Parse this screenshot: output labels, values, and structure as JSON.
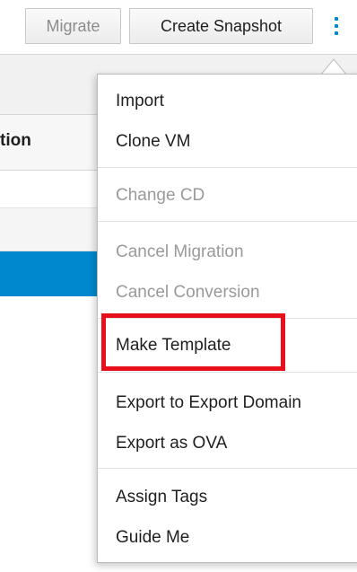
{
  "toolbar": {
    "migrate_label": "Migrate",
    "snapshot_label": "Create Snapshot",
    "more_icon": "kebab-vertical-icon"
  },
  "grid": {
    "column_header_fragment": "tion"
  },
  "menu": {
    "items": [
      {
        "label": "Import",
        "disabled": false
      },
      {
        "label": "Clone VM",
        "disabled": false
      },
      {
        "label": "Change CD",
        "disabled": true
      },
      {
        "label": "Cancel Migration",
        "disabled": true
      },
      {
        "label": "Cancel Conversion",
        "disabled": true
      },
      {
        "label": "Make Template",
        "disabled": false,
        "highlighted": true
      },
      {
        "label": "Export to Export Domain",
        "disabled": false
      },
      {
        "label": "Export as OVA",
        "disabled": false
      },
      {
        "label": "Assign Tags",
        "disabled": false
      },
      {
        "label": "Guide Me",
        "disabled": false
      }
    ]
  },
  "colors": {
    "accent": "#0088ce",
    "highlight": "#e8111b",
    "disabled_text": "#9a9a9a"
  }
}
